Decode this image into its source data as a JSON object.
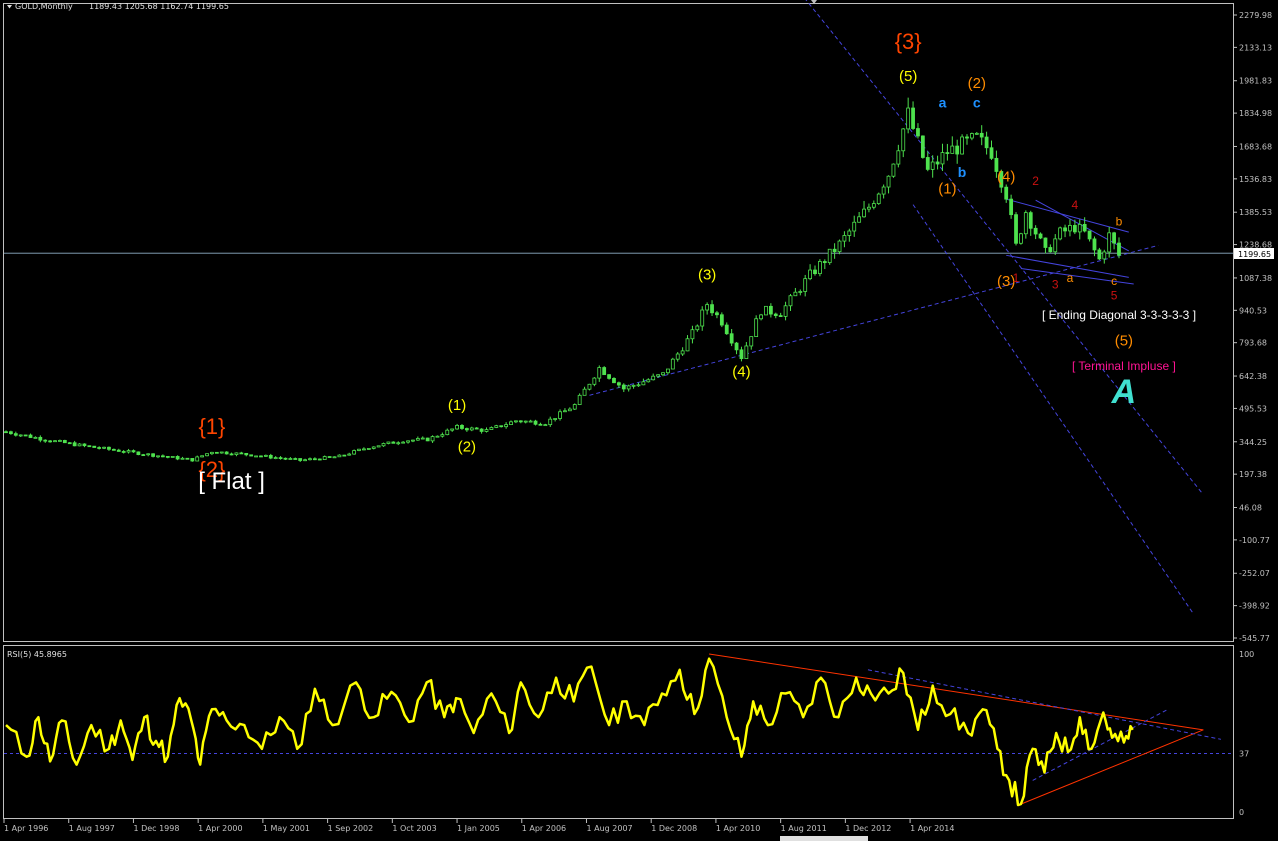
{
  "header": {
    "symbol": "GOLD,Monthly",
    "ohlc": "1189.43 1205.68 1162.74 1199.65",
    "price_tag": "1199.65"
  },
  "colors": {
    "background": "#000000",
    "frame": "#c0c0c0",
    "candle": "#4ee24e",
    "rsi_line": "#ffff00",
    "trendline": "#4444dd",
    "rsi_trendline": "#ff3300",
    "wave_primary": "#ff4500",
    "wave_intermediate": "#ffff00",
    "wave_orange": "#ff8c00",
    "wave_blue": "#1e90ff",
    "wave_red": "#cc1111",
    "text_white": "#ffffff",
    "terminal_label": "#ff1493",
    "symbol_A": "#40e0d0"
  },
  "chart_data": [
    {
      "type": "candlestick",
      "title": "GOLD,Monthly",
      "y_ticks": [
        "2279.98",
        "2133.13",
        "1981.83",
        "1834.98",
        "1683.68",
        "1536.83",
        "1385.53",
        "1238.68",
        "1087.38",
        "940.53",
        "793.68",
        "642.38",
        "495.53",
        "344.25",
        "197.38",
        "46.08",
        "-100.77",
        "-252.07",
        "-398.92",
        "-545.77"
      ],
      "ylim": [
        -545.77,
        2279.98
      ],
      "x_ticks": [
        "1 Apr 1996",
        "1 Aug 1997",
        "1 Dec 1998",
        "1 Apr 2000",
        "1 May 2001",
        "1 Sep 2002",
        "1 Oct 2003",
        "1 Jan 2005",
        "1 Apr 2006",
        "1 Aug 2007",
        "1 Dec 2008",
        "1 Apr 2010",
        "1 Aug 2011",
        "1 Dec 2012",
        "1 Apr 2014"
      ],
      "last_price": 1199.65,
      "series_close": [
        [
          "1996-04",
          390
        ],
        [
          "1997-01",
          350
        ],
        [
          "1997-08",
          325
        ],
        [
          "1998-06",
          295
        ],
        [
          "1999-06",
          262
        ],
        [
          "1999-10",
          300
        ],
        [
          "2000-06",
          285
        ],
        [
          "2001-04",
          260
        ],
        [
          "2001-12",
          278
        ],
        [
          "2002-06",
          320
        ],
        [
          "2003-01",
          350
        ],
        [
          "2003-06",
          355
        ],
        [
          "2003-12",
          410
        ],
        [
          "2004-06",
          395
        ],
        [
          "2004-12",
          440
        ],
        [
          "2005-06",
          430
        ],
        [
          "2005-12",
          510
        ],
        [
          "2006-05",
          680
        ],
        [
          "2006-10",
          585
        ],
        [
          "2007-06",
          650
        ],
        [
          "2007-12",
          835
        ],
        [
          "2008-03",
          970
        ],
        [
          "2008-06",
          890
        ],
        [
          "2008-10",
          730
        ],
        [
          "2009-02",
          940
        ],
        [
          "2009-06",
          930
        ],
        [
          "2009-12",
          1100
        ],
        [
          "2010-06",
          1240
        ],
        [
          "2010-12",
          1410
        ],
        [
          "2011-04",
          1560
        ],
        [
          "2011-08",
          1830
        ],
        [
          "2011-12",
          1570
        ],
        [
          "2012-04",
          1660
        ],
        [
          "2012-10",
          1720
        ],
        [
          "2013-01",
          1660
        ],
        [
          "2013-04",
          1470
        ],
        [
          "2013-06",
          1230
        ],
        [
          "2013-08",
          1390
        ],
        [
          "2013-12",
          1200
        ],
        [
          "2014-03",
          1290
        ],
        [
          "2014-06",
          1320
        ],
        [
          "2014-08",
          1290
        ],
        [
          "2014-11",
          1170
        ],
        [
          "2015-01",
          1280
        ],
        [
          "2015-03",
          1190
        ]
      ],
      "annotations": [
        {
          "text": "{1}",
          "date": "1999-10",
          "price": 380,
          "color": "wave_primary"
        },
        {
          "text": "{2}",
          "date": "1999-10",
          "price": 185,
          "color": "wave_primary"
        },
        {
          "text": "[ Flat ]",
          "date": "2000-02",
          "price": 130,
          "color": "text_white"
        },
        {
          "text": "(1)",
          "date": "2003-12",
          "price": 488,
          "color": "wave_intermediate"
        },
        {
          "text": "(2)",
          "date": "2004-02",
          "price": 300,
          "color": "wave_intermediate"
        },
        {
          "text": "(3)",
          "date": "2008-03",
          "price": 1080,
          "color": "wave_intermediate"
        },
        {
          "text": "(4)",
          "date": "2008-10",
          "price": 640,
          "color": "wave_intermediate"
        },
        {
          "text": "{3}",
          "date": "2011-08",
          "price": 2125,
          "color": "wave_primary"
        },
        {
          "text": "(5)",
          "date": "2011-08",
          "price": 1980,
          "color": "wave_intermediate"
        },
        {
          "text": "(2)",
          "date": "2012-10",
          "price": 1950,
          "color": "wave_orange"
        },
        {
          "text": "a",
          "date": "2012-03",
          "price": 1860,
          "color": "wave_blue"
        },
        {
          "text": "c",
          "date": "2012-10",
          "price": 1860,
          "color": "wave_blue"
        },
        {
          "text": "b",
          "date": "2012-07",
          "price": 1545,
          "color": "wave_blue"
        },
        {
          "text": "(1)",
          "date": "2012-04",
          "price": 1470,
          "color": "wave_orange"
        },
        {
          "text": "(4)",
          "date": "2013-04",
          "price": 1525,
          "color": "wave_orange"
        },
        {
          "text": "2",
          "date": "2013-10",
          "price": 1510,
          "color": "wave_red"
        },
        {
          "text": "4",
          "date": "2014-06",
          "price": 1400,
          "color": "wave_red"
        },
        {
          "text": "b",
          "date": "2015-03",
          "price": 1325,
          "color": "wave_orange"
        },
        {
          "text": "(3)",
          "date": "2013-04",
          "price": 1050,
          "color": "wave_orange"
        },
        {
          "text": "1",
          "date": "2013-06",
          "price": 1070,
          "color": "wave_red"
        },
        {
          "text": "a",
          "date": "2014-05",
          "price": 1070,
          "color": "wave_orange"
        },
        {
          "text": "c",
          "date": "2015-02",
          "price": 1055,
          "color": "wave_orange"
        },
        {
          "text": "3",
          "date": "2014-02",
          "price": 1040,
          "color": "wave_red"
        },
        {
          "text": "5",
          "date": "2015-02",
          "price": 990,
          "color": "wave_red"
        },
        {
          "text": "[ Ending Diagonal 3-3-3-3-3 ]",
          "date": "2015-03",
          "price": 900,
          "color": "text_white"
        },
        {
          "text": "(5)",
          "date": "2015-04",
          "price": 780,
          "color": "wave_orange"
        },
        {
          "text": "[ Terminal Impluse ]",
          "date": "2015-04",
          "price": 670,
          "color": "terminal_label"
        },
        {
          "text": "A",
          "date": "2015-04",
          "price": 520,
          "color": "symbol_A"
        }
      ],
      "trendlines": [
        {
          "from": [
            "2006-03",
            555
          ],
          "to": [
            "2015-11",
            1235
          ],
          "color": "trendline"
        },
        {
          "from": [
            "2009-01",
            2630
          ],
          "to": [
            "2016-08",
            110
          ],
          "color": "trendline"
        },
        {
          "from": [
            "2011-09",
            1420
          ],
          "to": [
            "2016-06",
            -430
          ],
          "color": "trendline"
        },
        {
          "from": [
            "2013-04",
            1445
          ],
          "to": [
            "2015-05",
            1295
          ],
          "color": "trendline"
        },
        {
          "from": [
            "2013-04",
            1190
          ],
          "to": [
            "2015-05",
            1090
          ],
          "color": "trendline"
        },
        {
          "from": [
            "2013-10",
            1440
          ],
          "to": [
            "2015-05",
            1210
          ],
          "color": "trendline"
        },
        {
          "from": [
            "2013-07",
            1130
          ],
          "to": [
            "2015-06",
            1060
          ],
          "color": "trendline"
        }
      ]
    },
    {
      "type": "line",
      "title": "RSI(5) 45.8965",
      "ylim": [
        0,
        100
      ],
      "y_ticks": [
        "100",
        "37",
        "0"
      ],
      "reference_level": 37,
      "values": [
        [
          1996.25,
          55
        ],
        [
          1996.6,
          35
        ],
        [
          1996.8,
          60
        ],
        [
          1997.0,
          32
        ],
        [
          1997.2,
          58
        ],
        [
          1997.45,
          30
        ],
        [
          1997.7,
          55
        ],
        [
          1998.0,
          40
        ],
        [
          1998.2,
          58
        ],
        [
          1998.4,
          33
        ],
        [
          1998.6,
          60
        ],
        [
          1998.8,
          45
        ],
        [
          1999.0,
          35
        ],
        [
          1999.2,
          72
        ],
        [
          1999.4,
          58
        ],
        [
          1999.55,
          30
        ],
        [
          1999.75,
          65
        ],
        [
          2000.0,
          58
        ],
        [
          2000.3,
          55
        ],
        [
          2000.6,
          40
        ],
        [
          2000.9,
          60
        ],
        [
          2001.2,
          40
        ],
        [
          2001.5,
          78
        ],
        [
          2001.8,
          55
        ],
        [
          2002.2,
          82
        ],
        [
          2002.5,
          60
        ],
        [
          2002.8,
          76
        ],
        [
          2003.1,
          57
        ],
        [
          2003.4,
          82
        ],
        [
          2003.7,
          60
        ],
        [
          2003.9,
          72
        ],
        [
          2004.2,
          50
        ],
        [
          2004.5,
          75
        ],
        [
          2004.8,
          50
        ],
        [
          2005.0,
          82
        ],
        [
          2005.3,
          60
        ],
        [
          2005.6,
          85
        ],
        [
          2005.9,
          70
        ],
        [
          2006.2,
          92
        ],
        [
          2006.5,
          55
        ],
        [
          2006.8,
          70
        ],
        [
          2007.1,
          55
        ],
        [
          2007.4,
          75
        ],
        [
          2007.7,
          90
        ],
        [
          2007.95,
          62
        ],
        [
          2008.2,
          97
        ],
        [
          2008.5,
          60
        ],
        [
          2008.75,
          35
        ],
        [
          2008.95,
          70
        ],
        [
          2009.2,
          55
        ],
        [
          2009.5,
          75
        ],
        [
          2009.8,
          60
        ],
        [
          2010.1,
          85
        ],
        [
          2010.4,
          60
        ],
        [
          2010.7,
          85
        ],
        [
          2010.95,
          75
        ],
        [
          2011.25,
          75
        ],
        [
          2011.5,
          88
        ],
        [
          2011.75,
          52
        ],
        [
          2012.0,
          80
        ],
        [
          2012.3,
          62
        ],
        [
          2012.6,
          50
        ],
        [
          2012.85,
          65
        ],
        [
          2013.1,
          40
        ],
        [
          2013.3,
          20
        ],
        [
          2013.5,
          5
        ],
        [
          2013.7,
          40
        ],
        [
          2013.9,
          25
        ],
        [
          2014.1,
          50
        ],
        [
          2014.3,
          38
        ],
        [
          2014.5,
          60
        ],
        [
          2014.7,
          40
        ],
        [
          2014.9,
          63
        ],
        [
          2015.05,
          47
        ],
        [
          2015.25,
          44
        ],
        [
          2015.4,
          52
        ]
      ],
      "trendlines": [
        {
          "from": [
            2008.2,
            100
          ],
          "to": [
            2016.6,
            52
          ],
          "color": "rsi_trendline"
        },
        {
          "from": [
            2013.5,
            5
          ],
          "to": [
            2016.6,
            52
          ],
          "color": "rsi_trendline"
        },
        {
          "from": [
            2010.9,
            90
          ],
          "to": [
            2016.9,
            46
          ],
          "color": "trendline"
        },
        {
          "from": [
            2013.7,
            20
          ],
          "to": [
            2016.0,
            65
          ],
          "color": "trendline"
        }
      ]
    }
  ]
}
